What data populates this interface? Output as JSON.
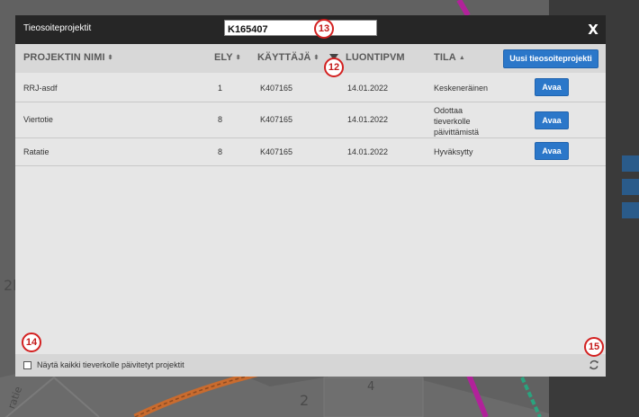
{
  "modal": {
    "title": "Tieosoiteprojektit",
    "search": {
      "value": "K165407",
      "placeholder": ""
    },
    "close_label": "X",
    "new_project_label": "Uusi tieosoiteprojekti",
    "columns": [
      {
        "label": "PROJEKTIN NIMI",
        "sort": "⬍"
      },
      {
        "label": "ELY",
        "sort": "⬍"
      },
      {
        "label": "KÄYTTÄJÄ",
        "sort": "⬍"
      },
      {
        "label": "LUONTIPVM",
        "sort": ""
      },
      {
        "label": "TILA",
        "sort": "▲"
      }
    ],
    "rows": [
      {
        "name": "RRJ-asdf",
        "ely": "1",
        "user": "K407165",
        "date": "14.01.2022",
        "state": "Keskeneräinen",
        "action": "Avaa"
      },
      {
        "name": "Viertotie",
        "ely": "8",
        "user": "K407165",
        "date": "14.01.2022",
        "state": "Odottaa tieverkolle päivittämistä",
        "action": "Avaa"
      },
      {
        "name": "Ratatie",
        "ely": "8",
        "user": "K407165",
        "date": "14.01.2022",
        "state": "Hyväksytty",
        "action": "Avaa"
      }
    ],
    "footer": {
      "checkbox_label": "Näytä kaikki tieverkolle päivitetyt projektit",
      "refresh_icon": "refresh-icon"
    }
  },
  "callouts": {
    "search": "13",
    "sort": "12",
    "checkbox": "14",
    "refresh": "15"
  },
  "map_labels": {
    "left_label": "2b",
    "road_label": "2",
    "house_number": "4",
    "small_text": "ratie"
  },
  "colors": {
    "accent": "#2b77c9",
    "header": "#262626",
    "callout": "#d32020"
  }
}
